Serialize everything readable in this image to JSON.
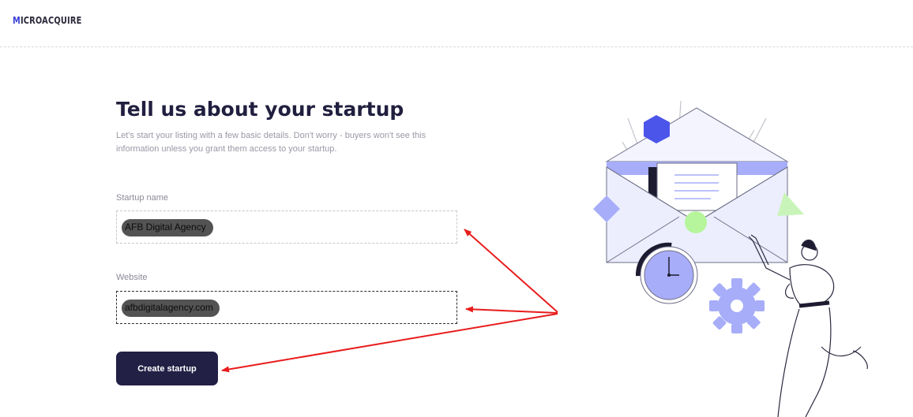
{
  "header": {
    "logo_text_first": "M",
    "logo_text_rest": "ICROACQUIRE"
  },
  "form": {
    "title": "Tell us about your startup",
    "subtitle": "Let's start your listing with a few basic details. Don't worry - buyers won't see this information unless you grant them access to your startup.",
    "startup_name_label": "Startup name",
    "startup_name_value": "AFB Digital Agency",
    "website_label": "Website",
    "website_value": "afbdigitalagency.com",
    "submit_label": "Create startup"
  },
  "colors": {
    "primary_button": "#232046",
    "annotation_arrow": "#e81c1c",
    "illustration_accent": "#a7adf8"
  }
}
